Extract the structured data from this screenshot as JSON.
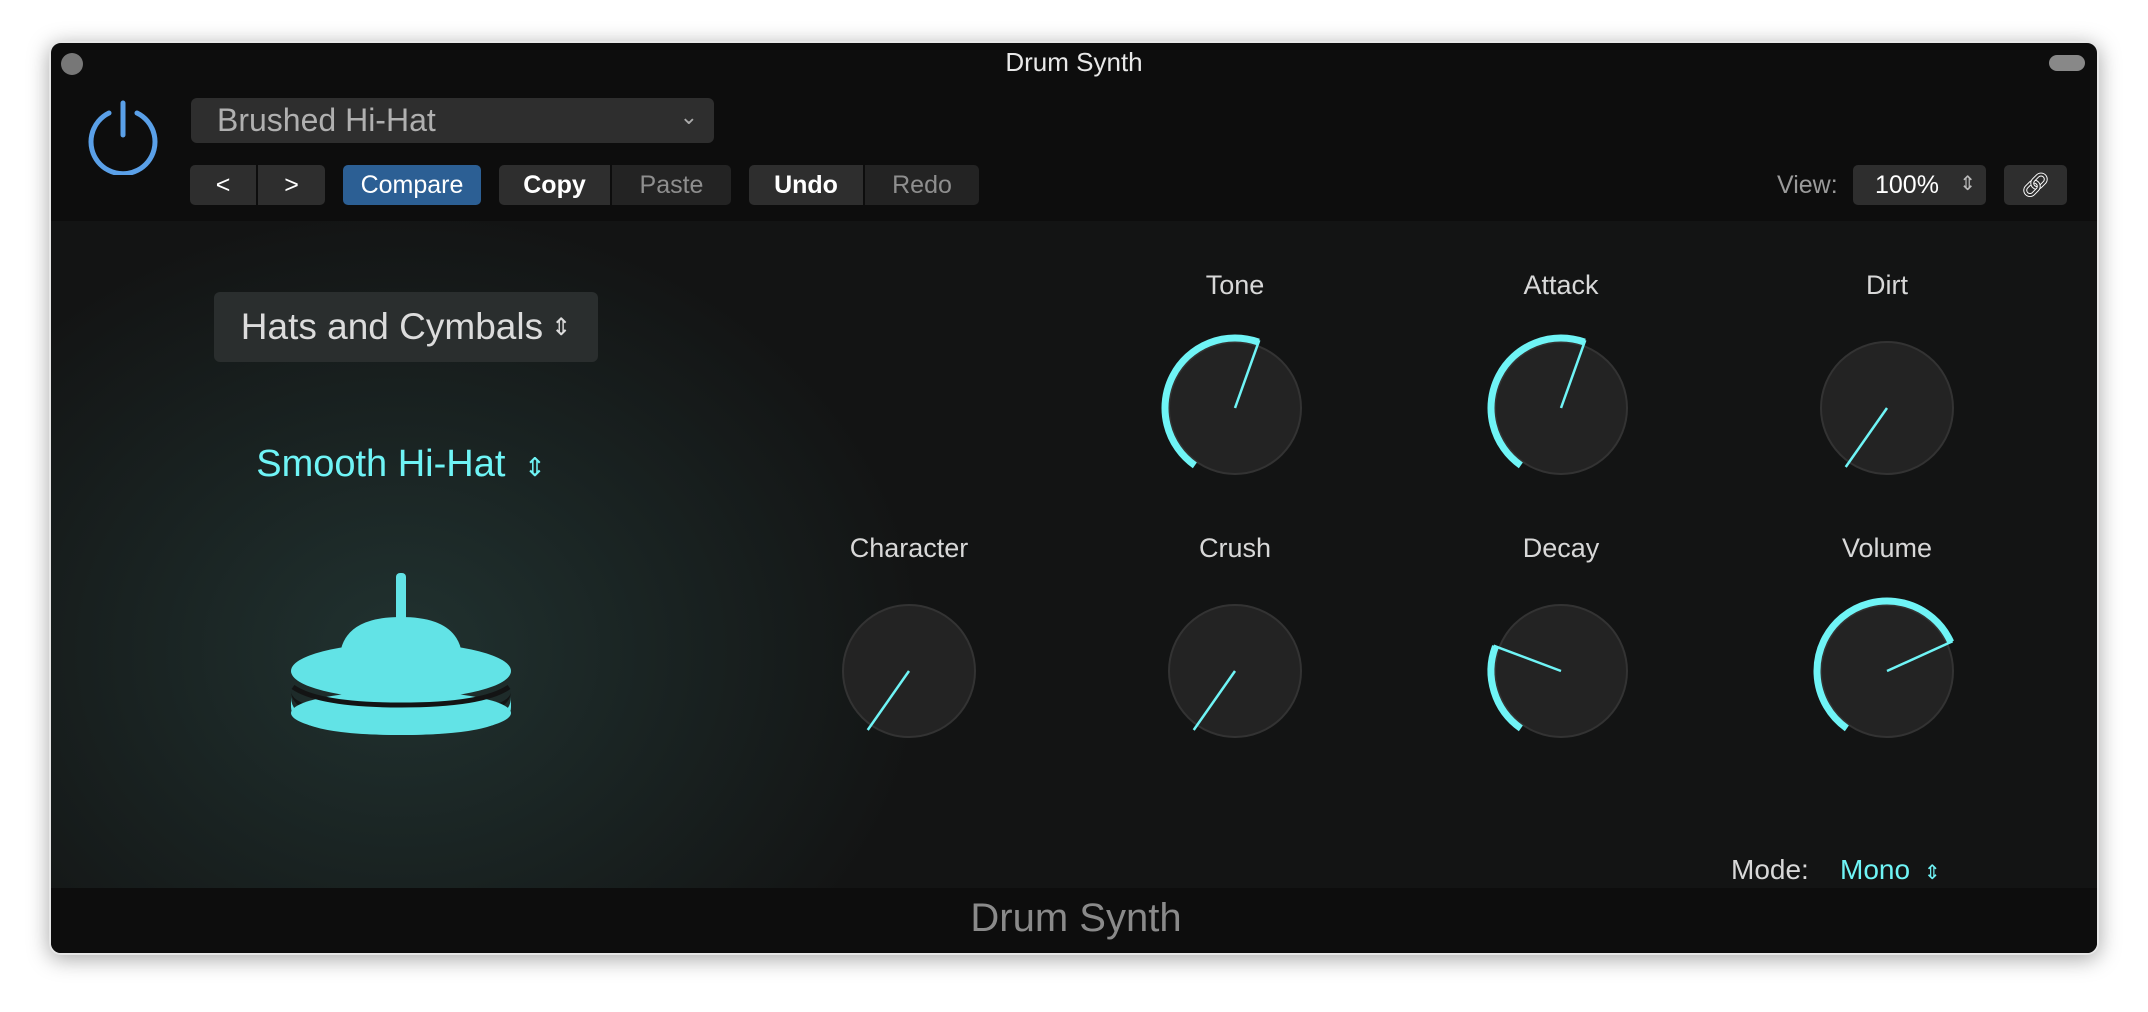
{
  "window": {
    "title": "Drum Synth"
  },
  "header": {
    "preset": "Brushed Hi-Hat",
    "prev": "<",
    "next": ">",
    "compare": "Compare",
    "copy": "Copy",
    "paste": "Paste",
    "undo": "Undo",
    "redo": "Redo",
    "view_label": "View:",
    "view_value": "100%"
  },
  "main": {
    "category": "Hats and Cymbals",
    "model": "Smooth Hi-Hat",
    "mode_label": "Mode:",
    "mode_value": "Mono",
    "knobs": [
      {
        "label": "Tone",
        "value": 0.61
      },
      {
        "label": "Attack",
        "value": 0.61
      },
      {
        "label": "Dirt",
        "value": 0.0
      },
      {
        "label": "Character",
        "value": 0.0
      },
      {
        "label": "Crush",
        "value": 0.0
      },
      {
        "label": "Decay",
        "value": 0.28
      },
      {
        "label": "Volume",
        "value": 0.78
      }
    ]
  },
  "footer": {
    "title": "Drum Synth"
  },
  "colors": {
    "accent": "#6ff4f6",
    "power": "#5aa0e8",
    "compare": "#2c5f94"
  }
}
